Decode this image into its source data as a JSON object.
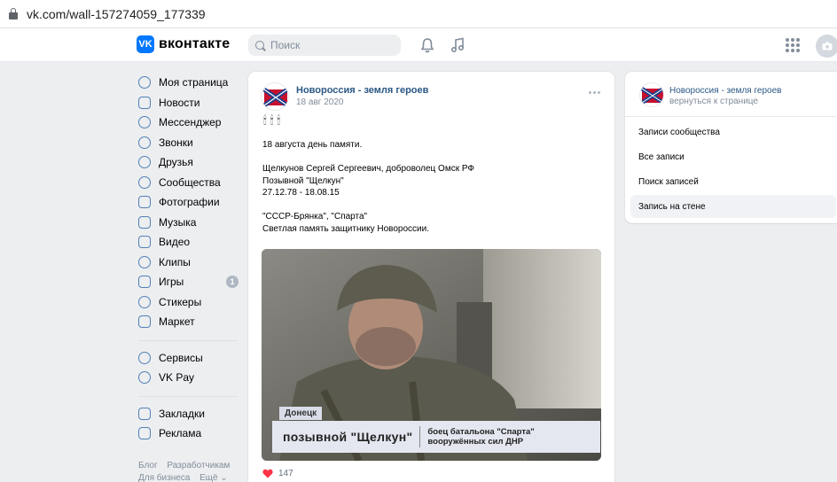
{
  "browser": {
    "url": "vk.com/wall-157274059_177339"
  },
  "header": {
    "logo_mark": "VK",
    "logo_text": "вконтакте",
    "search_placeholder": "Поиск"
  },
  "sidebar": {
    "items": [
      {
        "label": "Моя страница",
        "icon": "profile-icon"
      },
      {
        "label": "Новости",
        "icon": "news-icon"
      },
      {
        "label": "Мессенджер",
        "icon": "messenger-icon"
      },
      {
        "label": "Звонки",
        "icon": "phone-icon"
      },
      {
        "label": "Друзья",
        "icon": "friends-icon"
      },
      {
        "label": "Сообщества",
        "icon": "communities-icon"
      },
      {
        "label": "Фотографии",
        "icon": "photos-icon"
      },
      {
        "label": "Музыка",
        "icon": "music-icon"
      },
      {
        "label": "Видео",
        "icon": "video-icon"
      },
      {
        "label": "Клипы",
        "icon": "clips-icon"
      },
      {
        "label": "Игры",
        "icon": "games-icon",
        "badge": "1"
      },
      {
        "label": "Стикеры",
        "icon": "stickers-icon"
      },
      {
        "label": "Маркет",
        "icon": "market-icon"
      }
    ],
    "items2": [
      {
        "label": "Сервисы",
        "icon": "services-icon"
      },
      {
        "label": "VK Pay",
        "icon": "vkpay-icon"
      }
    ],
    "items3": [
      {
        "label": "Закладки",
        "icon": "bookmarks-icon"
      },
      {
        "label": "Реклама",
        "icon": "ads-icon"
      }
    ],
    "footer": {
      "blog": "Блог",
      "developers": "Разработчикам",
      "business": "Для бизнеса",
      "more": "Ещё ⌄"
    }
  },
  "post": {
    "author": "Новороссия - земля героев",
    "date": "18 авг 2020",
    "candles": "🕯🕯🕯",
    "text": {
      "line1": "18 августа день памяти.",
      "line2": "Щелкунов Сергей Сергеевич, доброволец Омск РФ",
      "line3": "Позывной \"Щелкун\"",
      "line4": "27.12.78 - 18.08.15",
      "line5": "\"СССР-Брянка\", \"Спарта\"",
      "line6": "Светлая память защитнику Новороссии."
    },
    "image_caption": {
      "location": "Донецк",
      "callsign": "позывной \"Щелкун\"",
      "role_line1": "боец батальона \"Спарта\"",
      "role_line2": "вооружённых сил ДНР"
    },
    "likes": "147"
  },
  "rightcard": {
    "name": "Новороссия - земля героев",
    "back": "вернуться к странице",
    "items": [
      "Записи сообщества",
      "Все записи",
      "Поиск записей",
      "Запись на стене"
    ]
  }
}
